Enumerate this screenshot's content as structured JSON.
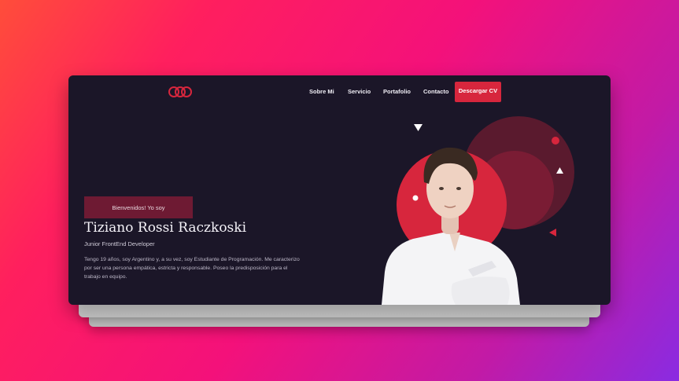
{
  "window": {
    "background": "#1b1628"
  },
  "header": {
    "logo_icon": "three-rings-logo",
    "nav": [
      "Sobre Mi",
      "Servicio",
      "Portafolio",
      "Contacto"
    ],
    "cta_label": "Descargar CV"
  },
  "hero": {
    "greeting": "Bienvenidos! Yo soy",
    "name": "Tiziano Rossi Raczkoski",
    "role": "Junior FrontEnd Developer",
    "bio": "Tengo 19 años, soy Argentino y, a su vez, soy Estudiante de Programación. Me caracterizo por ser una persona empática, estricta y responsable. Poseo la predisposición para el trabajo en equipo.",
    "portrait_icon": "developer-portrait"
  },
  "colors": {
    "accent": "#d7263d",
    "greeting_bg": "#6e1a33",
    "dark_circle": "#5a1a2e"
  }
}
